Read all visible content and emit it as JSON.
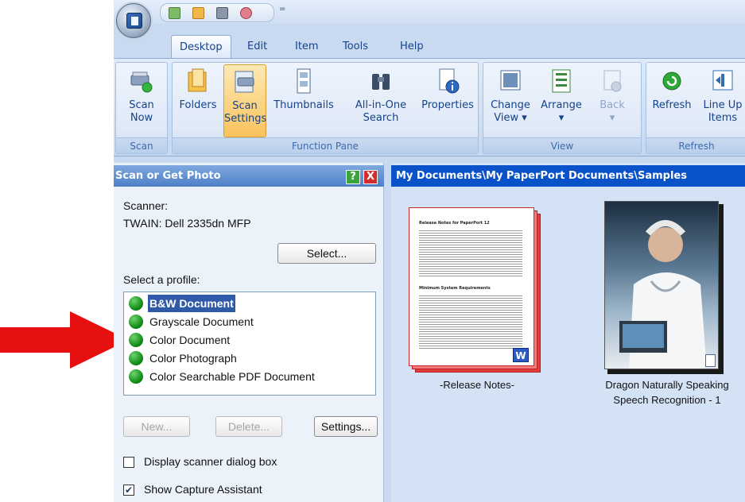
{
  "ribbon": {
    "tabs": [
      {
        "label": "Desktop"
      },
      {
        "label": "Edit"
      },
      {
        "label": "Item"
      },
      {
        "label": "Tools"
      },
      {
        "label": "Help"
      }
    ],
    "groups": {
      "scan": {
        "label": "Scan",
        "scan_now": "Scan\nNow"
      },
      "function_pane": {
        "label": "Function Pane",
        "folders": "Folders",
        "scan_settings": "Scan\nSettings",
        "thumbnails": "Thumbnails",
        "all_in_one_search": "All-in-One\nSearch",
        "properties": "Properties"
      },
      "view": {
        "label": "View",
        "change_view": "Change\nView",
        "arrange": "Arrange",
        "back": "Back"
      },
      "refresh": {
        "label": "Refresh",
        "refresh": "Refresh",
        "line_up_items": "Line Up\nItems"
      }
    },
    "dropdown_arrow": "▾"
  },
  "quick_access": {
    "dropdown": "="
  },
  "left_pane": {
    "title": "Scan or Get Photo",
    "help": "?",
    "close": "X",
    "scanner_label": "Scanner:",
    "scanner_name": "TWAIN: Dell 2335dn MFP",
    "select_button": "Select...",
    "profile_label": "Select a profile:",
    "profiles": [
      {
        "label": "B&W Document"
      },
      {
        "label": "Grayscale Document"
      },
      {
        "label": "Color Document"
      },
      {
        "label": "Color Photograph"
      },
      {
        "label": "Color Searchable PDF Document"
      }
    ],
    "new_button": "New...",
    "delete_button": "Delete...",
    "settings_button": "Settings...",
    "display_dialog_label": "Display scanner dialog box",
    "display_dialog_checked": false,
    "show_capture_label": "Show Capture Assistant",
    "show_capture_checked": true,
    "check_mark": "✔"
  },
  "right_pane": {
    "path": "My Documents\\My PaperPort Documents\\Samples",
    "items": [
      {
        "label": "-Release Notes-"
      },
      {
        "label": "Dragon Naturally Speaking\nSpeech Recognition - 1"
      }
    ],
    "doc_title": "Release Notes for PaperPort 12",
    "doc_heading": "Minimum System Requirements",
    "word_badge": "W"
  },
  "colors": {
    "annotation_arrow": "#e61010",
    "ribbon_bg": "#dfeaf8",
    "pane_header": "#0a52c9",
    "selected_profile": "#2f5aa8"
  }
}
